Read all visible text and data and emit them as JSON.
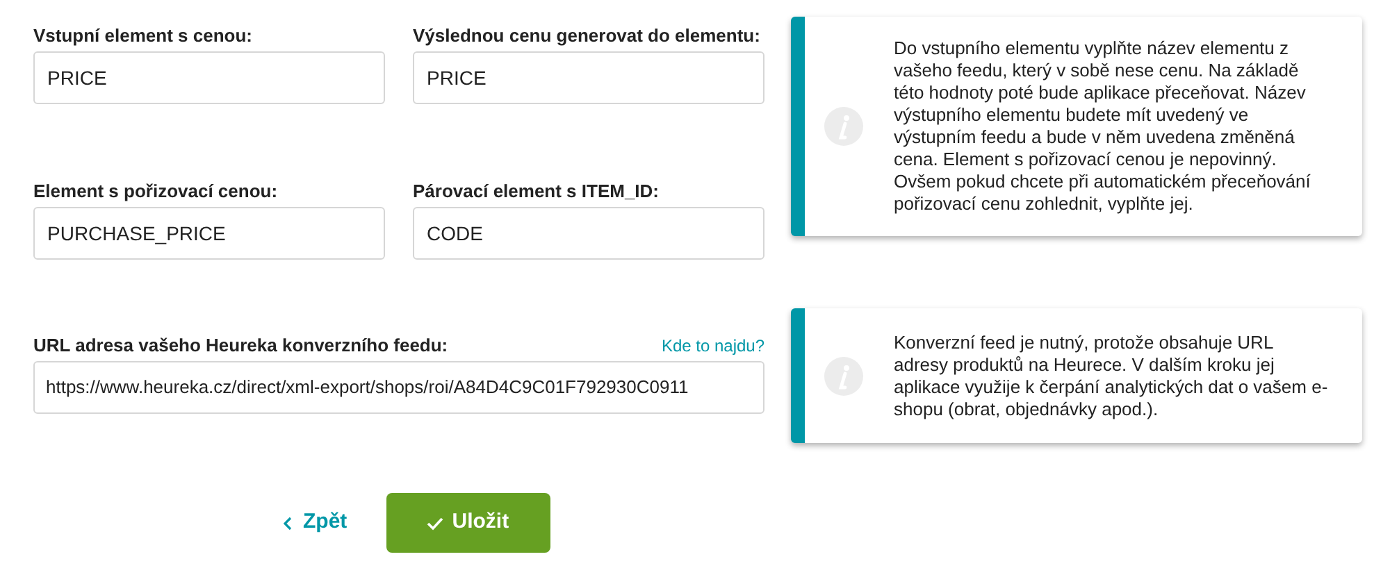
{
  "fields": [
    {
      "label": "Vstupní element s cenou:",
      "value": "PRICE"
    },
    {
      "label": "Výslednou cenu generovat do elementu:",
      "value": "PRICE"
    },
    {
      "label": "Element s pořizovací cenou:",
      "value": "PURCHASE_PRICE"
    },
    {
      "label": "Párovací element s ITEM_ID:",
      "value": "CODE"
    }
  ],
  "url_field": {
    "label": "URL adresa vašeho Heureka konverzního feedu:",
    "help_link": "Kde to najdu?",
    "value": "https://www.heureka.cz/direct/xml-export/shops/roi/A84D4C9C01F792930C0911"
  },
  "info_boxes": [
    "Do vstupního elementu vyplňte název elementu z vašeho feedu, který v sobě nese cenu. Na základě této hodnoty poté bude aplikace přeceňovat. Název výstupního elementu budete mít uvedený ve výstupním feedu a bude v něm uvedena změněná cena. Element s pořizovací cenou je nepovinný. Ovšem pokud chcete při automatickém přeceňování pořizovací cenu zohlednit, vyplňte jej.",
    "Konverzní feed je nutný, protože obsahuje URL adresy produktů na Heurece. V dalším kroku jej aplikace využije k čerpání analytických dat o vašem e-shopu (obrat, objednávky apod.)."
  ],
  "buttons": {
    "back": "Zpět",
    "save": "Uložit"
  }
}
